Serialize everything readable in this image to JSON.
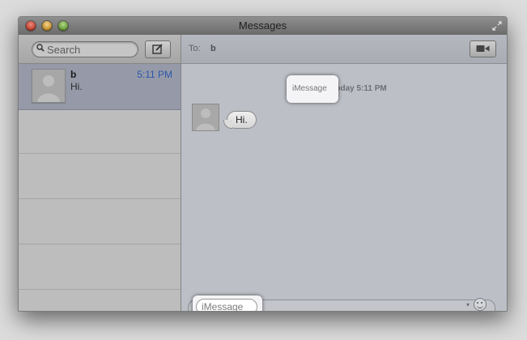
{
  "window": {
    "title": "Messages"
  },
  "sidebar": {
    "search_placeholder": "Search",
    "conversation": {
      "name": "b",
      "time": "5:11 PM",
      "preview": "Hi."
    }
  },
  "main": {
    "to_label": "To:",
    "recipient": "b",
    "timestamp_service": "iMessage",
    "timestamp_text": "Today 5:11 PM",
    "messages": [
      {
        "text": "Hi."
      }
    ],
    "input_placeholder": "iMessage"
  },
  "icons": {
    "search": "search-icon",
    "compose": "compose-icon",
    "video": "video-call-icon",
    "emoji": "emoji-icon",
    "fullscreen": "fullscreen-icon"
  },
  "colors": {
    "accent": "#2d57a8",
    "selection": "#969aa8"
  }
}
